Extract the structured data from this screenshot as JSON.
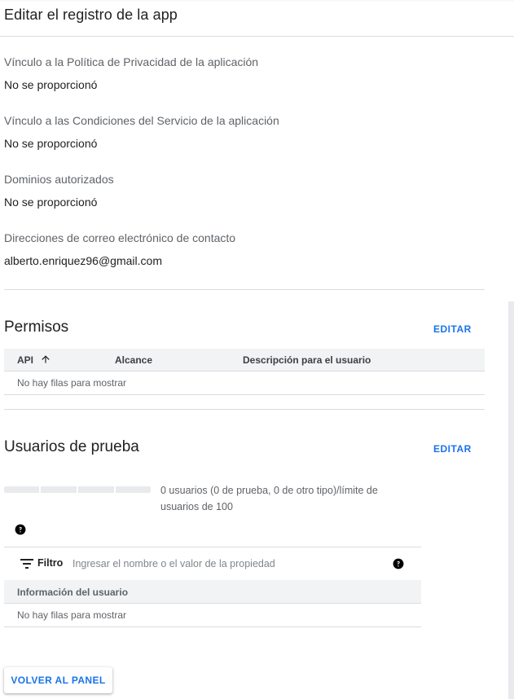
{
  "header": {
    "title": "Editar el registro de la app"
  },
  "details": {
    "privacy_label": "Vínculo a la Política de Privacidad de la aplicación",
    "privacy_value": "No se proporcionó",
    "tos_label": "Vínculo a las Condiciones del Servicio de la aplicación",
    "tos_value": "No se proporcionó",
    "domains_label": "Dominios autorizados",
    "domains_value": "No se proporcionó",
    "contact_label": "Direcciones de correo electrónico de contacto",
    "contact_value": "alberto.enriquez96@gmail.com"
  },
  "permissions": {
    "title": "Permisos",
    "edit_label": "EDITAR",
    "columns": {
      "api": "API",
      "scope": "Alcance",
      "description": "Descripción para el usuario"
    },
    "empty_text": "No hay filas para mostrar",
    "sort_icon": "arrow-up-icon"
  },
  "test_users": {
    "title": "Usuarios de prueba",
    "edit_label": "EDITAR",
    "usage_fraction": 0,
    "usage_text": "0 usuarios (0 de prueba, 0 de otro tipo)/límite de usuarios de 100",
    "filter_label": "Filtro",
    "filter_placeholder": "Ingresar el nombre o el valor de la propiedad",
    "filter_value": "",
    "column_user_info": "Información del usuario",
    "empty_text": "No hay filas para mostrar"
  },
  "footer": {
    "back_label": "VOLVER AL PANEL"
  },
  "colors": {
    "accent": "#1a73e8",
    "text": "#202124",
    "muted": "#5f6368",
    "header_bg": "#f1f3f4",
    "divider": "#dadce0"
  }
}
